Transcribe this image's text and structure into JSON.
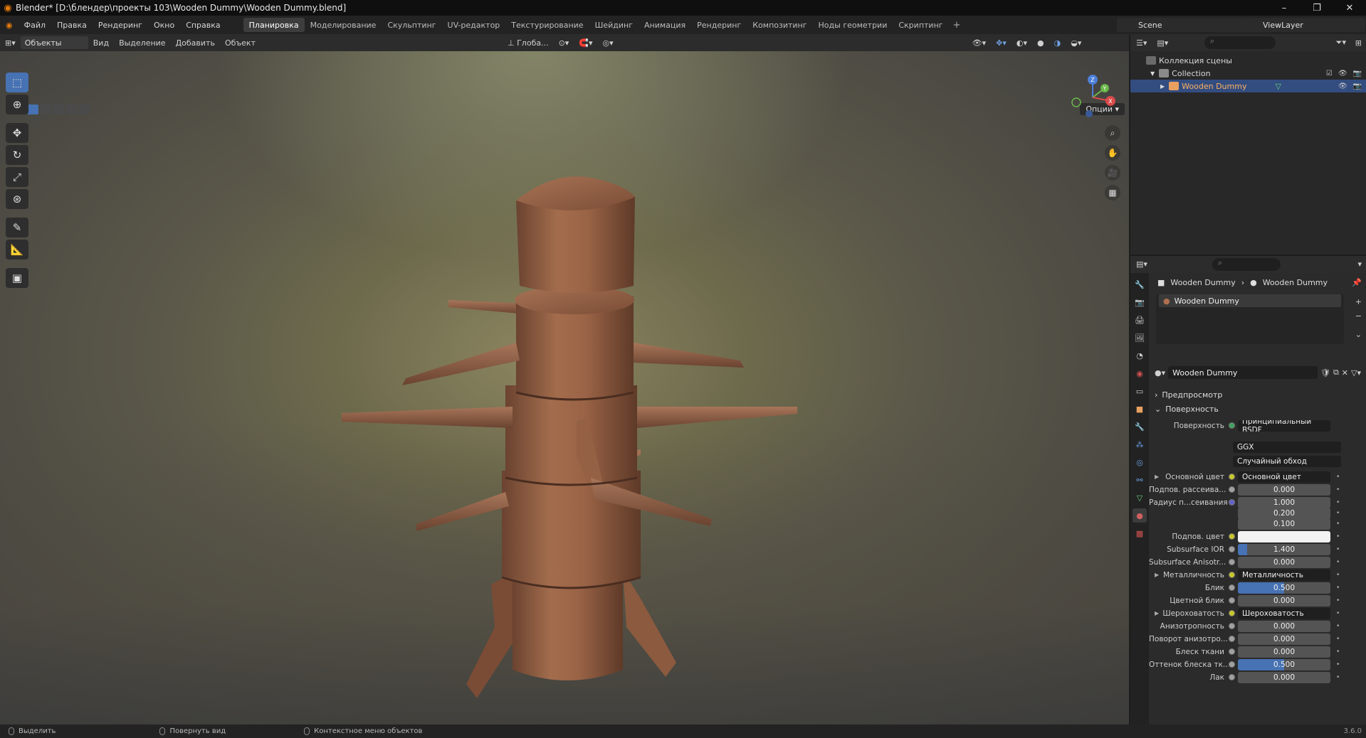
{
  "window": {
    "title": "Blender* [D:\\блендер\\проекты 103\\Wooden Dummy\\Wooden Dummy.blend]",
    "controls": [
      "–",
      "❐",
      "✕"
    ]
  },
  "menu": [
    "Файл",
    "Правка",
    "Рендеринг",
    "Окно",
    "Справка"
  ],
  "workspaces": [
    "Планировка",
    "Моделирование",
    "Скульптинг",
    "UV-редактор",
    "Текстурирование",
    "Шейдинг",
    "Анимация",
    "Рендеринг",
    "Композитинг",
    "Ноды геометрии",
    "Скриптинг"
  ],
  "active_workspace": "Планировка",
  "scene": "Scene",
  "view_layer": "ViewLayer",
  "viewport_header": {
    "mode": "Объекты",
    "menus": [
      "Вид",
      "Выделение",
      "Добавить",
      "Объект"
    ],
    "transform_orientation": "Глоба...",
    "options": "Опции"
  },
  "gizmo_axes": [
    "Z",
    "Y",
    "X"
  ],
  "outliner": {
    "root": "Коллекция сцены",
    "collection": "Collection",
    "object": "Wooden Dummy"
  },
  "properties": {
    "breadcrumb": [
      "Wooden Dummy",
      "Wooden Dummy"
    ],
    "slot": "Wooden Dummy",
    "material_name": "Wooden Dummy",
    "sections": {
      "preview": "Предпросмотр",
      "surface": "Поверхность"
    },
    "surface_label": "Поверхность",
    "surface_shader": "Принципиальный BSDF",
    "distribution": "GGX",
    "subsurface_method": "Случайный обход",
    "rows": [
      {
        "label": "Основной цвет",
        "value": "Основной цвет",
        "kind": "link",
        "expand": true
      },
      {
        "label": "Подпов. рассеива...",
        "value": "0.000",
        "kind": "num"
      },
      {
        "label": "Радиус п...сеивания",
        "value": "1.000",
        "kind": "num"
      },
      {
        "label": "",
        "value": "0.200",
        "kind": "num"
      },
      {
        "label": "",
        "value": "0.100",
        "kind": "num"
      },
      {
        "label": "Подпов. цвет",
        "value": "",
        "kind": "color"
      },
      {
        "label": "Subsurface IOR",
        "value": "1.400",
        "kind": "num",
        "fill": 0.1
      },
      {
        "label": "Subsurface Anisotr...",
        "value": "0.000",
        "kind": "num"
      },
      {
        "label": "Металличность",
        "value": "Металличность",
        "kind": "link",
        "expand": true
      },
      {
        "label": "Блик",
        "value": "0.500",
        "kind": "num",
        "fill": 0.5
      },
      {
        "label": "Цветной блик",
        "value": "0.000",
        "kind": "num"
      },
      {
        "label": "Шероховатость",
        "value": "Шероховатость",
        "kind": "link",
        "expand": true
      },
      {
        "label": "Анизотропность",
        "value": "0.000",
        "kind": "num"
      },
      {
        "label": "Поворот анизотро...",
        "value": "0.000",
        "kind": "num"
      },
      {
        "label": "Блеск ткани",
        "value": "0.000",
        "kind": "num"
      },
      {
        "label": "Оттенок блеска тк...",
        "value": "0.500",
        "kind": "num",
        "fill": 0.5
      },
      {
        "label": "Лак",
        "value": "0.000",
        "kind": "num"
      }
    ]
  },
  "status": {
    "select": "Выделить",
    "rotate": "Повернуть вид",
    "context": "Контекстное меню объектов",
    "version": "3.6.0"
  },
  "colors": {
    "accent": "#4772b3",
    "selection": "#334d80",
    "wood": "#8a5a3c"
  }
}
